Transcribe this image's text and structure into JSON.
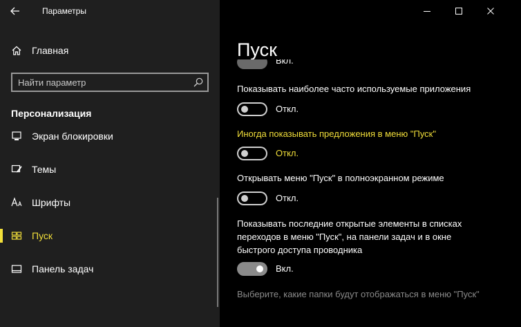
{
  "window": {
    "title": "Параметры"
  },
  "sidebar": {
    "home_label": "Главная",
    "search_placeholder": "Найти параметр",
    "section_title": "Персонализация",
    "items": [
      {
        "label": "Экран блокировки",
        "icon": "lock-screen-icon"
      },
      {
        "label": "Темы",
        "icon": "themes-icon"
      },
      {
        "label": "Шрифты",
        "icon": "fonts-icon"
      },
      {
        "label": "Пуск",
        "icon": "start-icon",
        "active": true
      },
      {
        "label": "Панель задач",
        "icon": "taskbar-icon"
      }
    ]
  },
  "main": {
    "title": "Пуск",
    "top_cut_state": "Вкл.",
    "settings": [
      {
        "label": "Показывать наиболее часто используемые приложения",
        "state": "Откл."
      },
      {
        "label": "Иногда показывать предложения в меню \"Пуск\"",
        "state": "Откл."
      },
      {
        "label": "Открывать меню \"Пуск\" в полноэкранном режиме",
        "state": "Откл."
      },
      {
        "label_lines": [
          "Показывать последние открытые элементы в списках",
          "переходов в меню \"Пуск\", на панели задач и в окне",
          "быстрого доступа проводника"
        ],
        "state": "Вкл."
      }
    ],
    "folders_link": "Выберите, какие папки будут отображаться в меню \"Пуск\""
  },
  "colors": {
    "accent": "#f2df3a",
    "sidebar_bg": "#1f1f1f",
    "content_bg": "#000000"
  }
}
